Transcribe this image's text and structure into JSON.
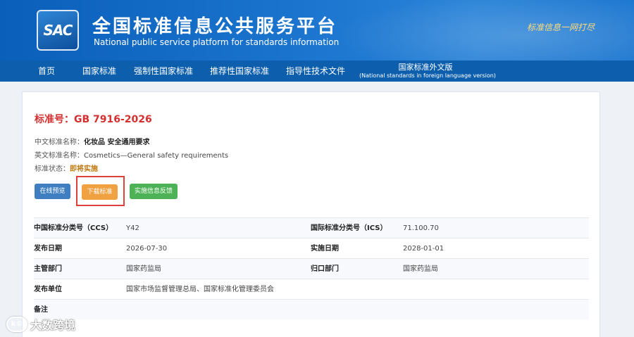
{
  "header": {
    "logo_text": "SAC",
    "title_cn": "全国标准信息公共服务平台",
    "title_en": "National public service platform  for standards information",
    "slogan": "标准信息一网打尽"
  },
  "nav": {
    "items": [
      "首页",
      "国家标准",
      "强制性国家标准",
      "推荐性国家标准",
      "指导性技术文件"
    ],
    "foreign_label": "国家标准外文版",
    "foreign_sub": "(National standards in foreign language version)"
  },
  "standard": {
    "number_label": "标准号：",
    "number": "GB 7916-2026",
    "cn_name_key": "中文标准名称：",
    "cn_name": "化妆品 安全通用要求",
    "en_name_key": "英文标准名称：",
    "en_name": "Cosmetics—General safety requirements",
    "status_key": "标准状态：",
    "status": "即将实施"
  },
  "buttons": {
    "preview": "在线预览",
    "download": "下载标准",
    "feedback": "实施信息反馈"
  },
  "details": {
    "ccs_key": "中国标准分类号（CCS）",
    "ccs": "Y42",
    "ics_key": "国际标准分类号（ICS）",
    "ics": "71.100.70",
    "pub_date_key": "发布日期",
    "pub_date": "2026-07-30",
    "impl_date_key": "实施日期",
    "impl_date": "2028-01-01",
    "authority_key": "主管部门",
    "authority": "国家药监局",
    "centralized_key": "归口部门",
    "centralized": "国家药监局",
    "publisher_key": "发布单位",
    "publisher": "国家市场监督管理总局、国家标准化管理委员会",
    "remark_key": "备注"
  },
  "watermark": {
    "logo": "k©",
    "text": "大数跨境"
  },
  "colors": {
    "header_blue": "#1a73cd",
    "nav_blue": "#0d5fae",
    "title_red": "#d32f2f",
    "status_orange": "#c07a12",
    "preview_blue": "#3f7fc1",
    "download_orange": "#f0a243",
    "feedback_green": "#4db255",
    "highlight_red": "#e0403b"
  }
}
